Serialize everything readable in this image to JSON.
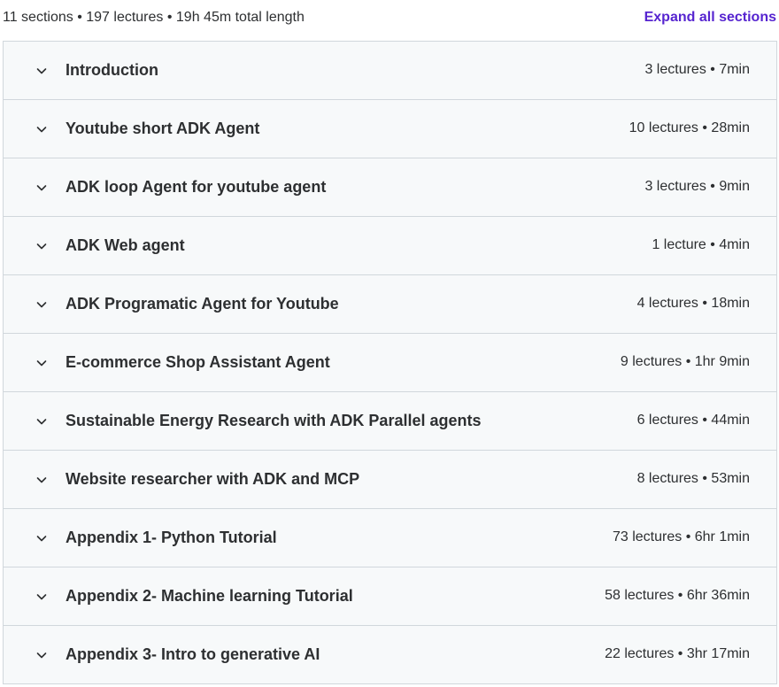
{
  "summary": {
    "text": "11 sections • 197 lectures • 19h 45m total length",
    "expand_all_label": "Expand all sections"
  },
  "sections": [
    {
      "title": "Introduction",
      "meta": "3 lectures • 7min",
      "icon": "chevron-down-icon"
    },
    {
      "title": "Youtube short ADK Agent",
      "meta": "10 lectures • 28min",
      "icon": "chevron-down-icon"
    },
    {
      "title": "ADK loop Agent for youtube agent",
      "meta": "3 lectures • 9min",
      "icon": "chevron-down-icon"
    },
    {
      "title": "ADK Web agent",
      "meta": "1 lecture • 4min",
      "icon": "chevron-down-icon"
    },
    {
      "title": "ADK Programatic Agent for Youtube",
      "meta": "4 lectures • 18min",
      "icon": "chevron-down-icon"
    },
    {
      "title": "E-commerce Shop Assistant Agent",
      "meta": "9 lectures • 1hr 9min",
      "icon": "chevron-down-icon"
    },
    {
      "title": "Sustainable Energy Research with ADK Parallel agents",
      "meta": "6 lectures • 44min",
      "icon": "chevron-down-icon"
    },
    {
      "title": "Website researcher with ADK and MCP",
      "meta": "8 lectures • 53min",
      "icon": "chevron-down-icon"
    },
    {
      "title": "Appendix 1- Python Tutorial",
      "meta": "73 lectures • 6hr 1min",
      "icon": "chevron-down-icon"
    },
    {
      "title": "Appendix 2- Machine learning Tutorial",
      "meta": "58 lectures • 6hr 36min",
      "icon": "chevron-down-icon"
    },
    {
      "title": "Appendix 3- Intro to generative AI",
      "meta": "22 lectures • 3hr 17min",
      "icon": "chevron-down-icon"
    }
  ],
  "colors": {
    "accent": "#5624d0",
    "text": "#2d2f31",
    "row_background": "#f7f9fa",
    "border": "#d1d7dc"
  }
}
